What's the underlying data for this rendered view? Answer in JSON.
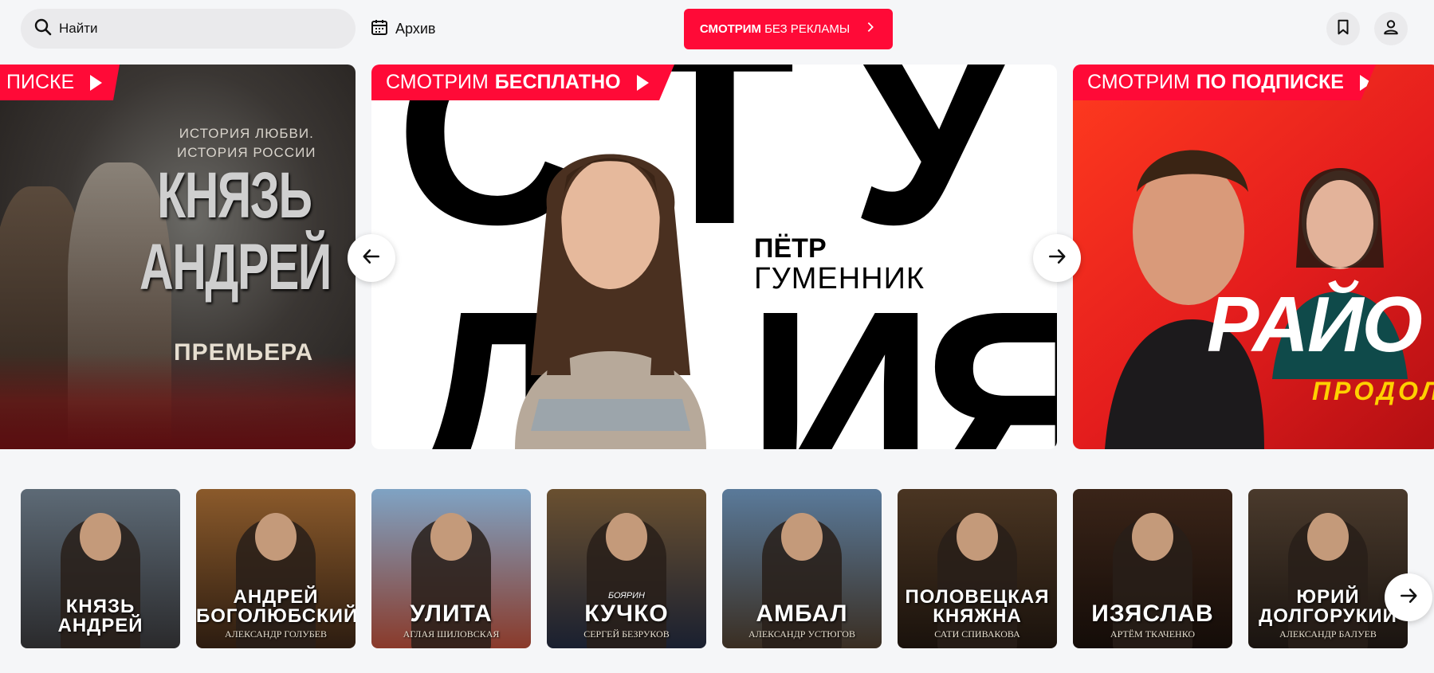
{
  "header": {
    "search": {
      "placeholder": "Найти",
      "icon": "search-icon"
    },
    "archive": {
      "label": "Архив",
      "icon": "calendar-icon"
    },
    "promo": {
      "bold": "СМОТРИМ",
      "rest": "БЕЗ РЕКЛАМЫ",
      "icon": "chevron-right-icon",
      "color": "#ff0a37"
    },
    "bookmark_icon": "bookmark-icon",
    "profile_icon": "user-icon"
  },
  "hero": {
    "left": {
      "ribbon_bold": "",
      "ribbon_text": "ПИСКЕ",
      "tagline": [
        "ИСТОРИЯ ЛЮБВИ.",
        "ИСТОРИЯ РОССИИ"
      ],
      "title": [
        "КНЯЗЬ",
        "АНДРЕЙ"
      ],
      "badge": "ПРЕМЬЕРА"
    },
    "center": {
      "ribbon_text": "СМОТРИМ",
      "ribbon_bold": "БЕСПЛАТНО",
      "first_name": "ПЁТР",
      "last_name": "ГУМЕННИК"
    },
    "right": {
      "ribbon_text": "СМОТРИМ",
      "ribbon_bold": "ПО ПОДПИСКЕ",
      "title": "РАЙО",
      "subtitle": "ПРОДОЛЖ"
    },
    "prev_icon": "arrow-left-icon",
    "next_icon": "arrow-right-icon",
    "accent": "#ff0a37"
  },
  "cards": [
    {
      "pre": "",
      "title": [
        "КНЯЗЬ",
        "АНДРЕЙ"
      ],
      "sub": "",
      "bg": [
        "#5d6a76",
        "#2a2a2c"
      ]
    },
    {
      "pre": "",
      "title": [
        "АНДРЕЙ",
        "БОГОЛЮБСКИЙ"
      ],
      "sub": "АЛЕКСАНДР ГОЛУБЕВ",
      "bg": [
        "#8b5a2b",
        "#2c1c10"
      ]
    },
    {
      "pre": "",
      "title": [
        "УЛИТА"
      ],
      "sub": "АГЛАЯ ШИЛОВСКАЯ",
      "bg": [
        "#7fa3c4",
        "#8a3a2a"
      ]
    },
    {
      "pre": "БОЯРИН",
      "title": [
        "КУЧКО"
      ],
      "sub": "СЕРГЕЙ БЕЗРУКОВ",
      "bg": [
        "#6a5030",
        "#1a2030"
      ]
    },
    {
      "pre": "",
      "title": [
        "АМБАЛ"
      ],
      "sub": "АЛЕКСАНДР УСТЮГОВ",
      "bg": [
        "#5a7a9a",
        "#3a2e22"
      ]
    },
    {
      "pre": "",
      "title": [
        "ПОЛОВЕЦКАЯ",
        "КНЯЖНА"
      ],
      "sub": "САТИ СПИВАКОВА",
      "bg": [
        "#4a3522",
        "#1a120c"
      ]
    },
    {
      "pre": "",
      "title": [
        "ИЗЯСЛАВ"
      ],
      "sub": "АРТЁМ ТКАЧЕНКО",
      "bg": [
        "#3a2418",
        "#140c08"
      ]
    },
    {
      "pre": "",
      "title": [
        "ЮРИЙ",
        "ДОЛГОРУКИЙ"
      ],
      "sub": "АЛЕКСАНДР БАЛУЕВ",
      "bg": [
        "#4a3a2c",
        "#1a1410"
      ]
    }
  ],
  "cards_next_icon": "arrow-right-icon"
}
